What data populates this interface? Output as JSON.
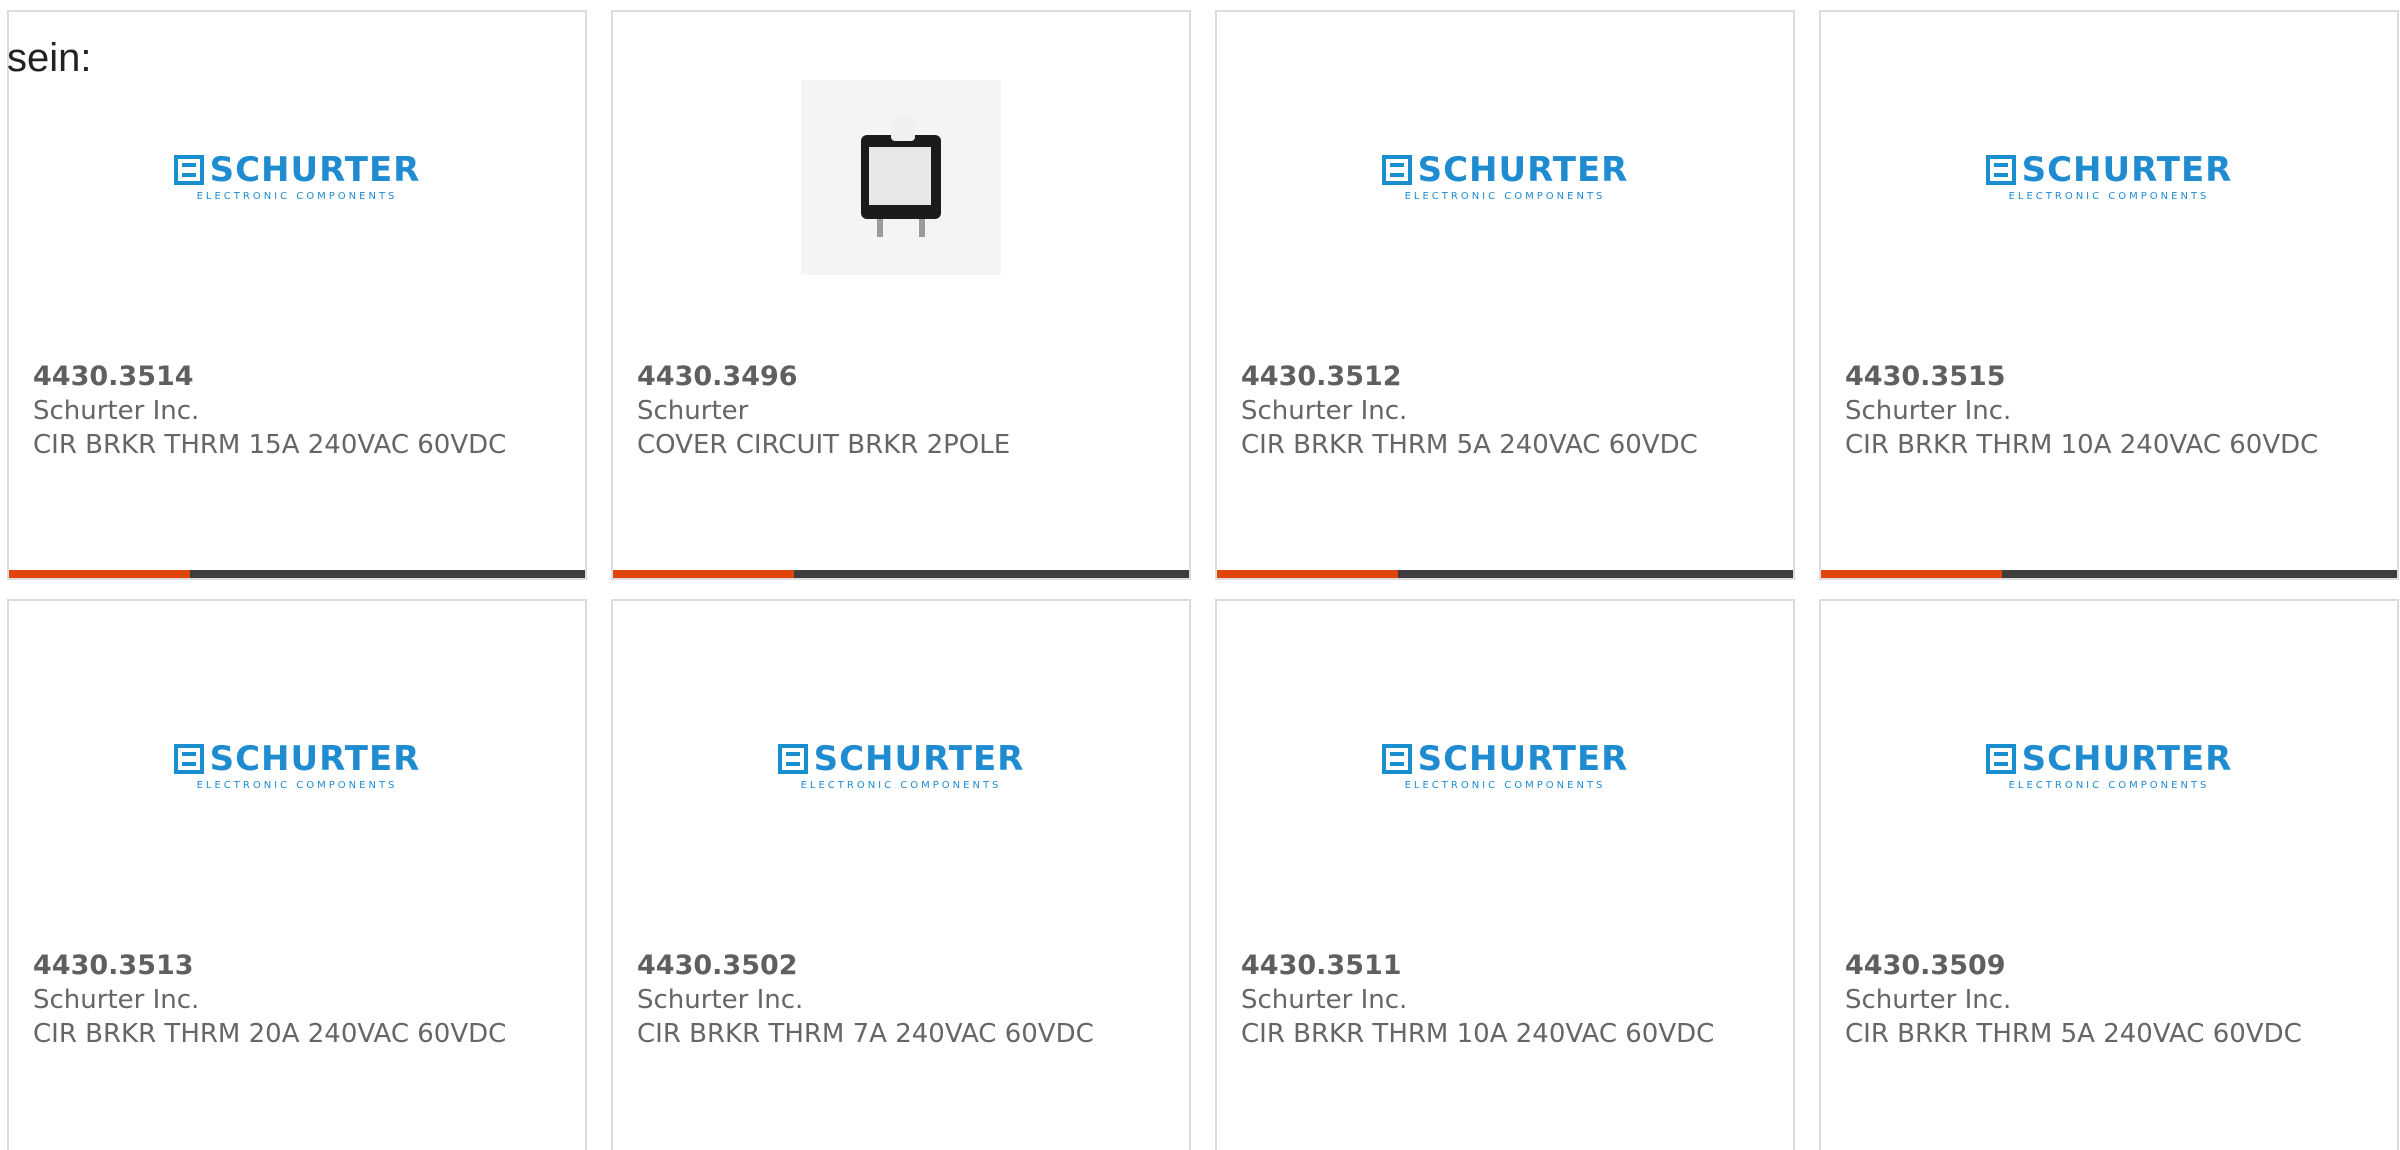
{
  "intro_text": "sein:",
  "colors": {
    "bar_accent": "#e2440d",
    "bar_track": "#3d3d3d",
    "logo_blue": "#1f8bd0"
  },
  "products": [
    {
      "part_number": "4430.3514",
      "manufacturer": "Schurter Inc.",
      "description": "CIR BRKR THRM 15A 240VAC 60VDC",
      "image": "schurter-logo"
    },
    {
      "part_number": "4430.3496",
      "manufacturer": "Schurter",
      "description": "COVER CIRCUIT BRKR 2POLE",
      "image": "product-photo"
    },
    {
      "part_number": "4430.3512",
      "manufacturer": "Schurter Inc.",
      "description": "CIR BRKR THRM 5A 240VAC 60VDC",
      "image": "schurter-logo"
    },
    {
      "part_number": "4430.3515",
      "manufacturer": "Schurter Inc.",
      "description": "CIR BRKR THRM 10A 240VAC 60VDC",
      "image": "schurter-logo"
    },
    {
      "part_number": "4430.3513",
      "manufacturer": "Schurter Inc.",
      "description": "CIR BRKR THRM 20A 240VAC 60VDC",
      "image": "schurter-logo"
    },
    {
      "part_number": "4430.3502",
      "manufacturer": "Schurter Inc.",
      "description": "CIR BRKR THRM 7A 240VAC 60VDC",
      "image": "schurter-logo"
    },
    {
      "part_number": "4430.3511",
      "manufacturer": "Schurter Inc.",
      "description": "CIR BRKR THRM 10A 240VAC 60VDC",
      "image": "schurter-logo"
    },
    {
      "part_number": "4430.3509",
      "manufacturer": "Schurter Inc.",
      "description": "CIR BRKR THRM 5A 240VAC 60VDC",
      "image": "schurter-logo"
    }
  ],
  "logo": {
    "brand": "SCHURTER",
    "tagline": "ELECTRONIC COMPONENTS"
  }
}
